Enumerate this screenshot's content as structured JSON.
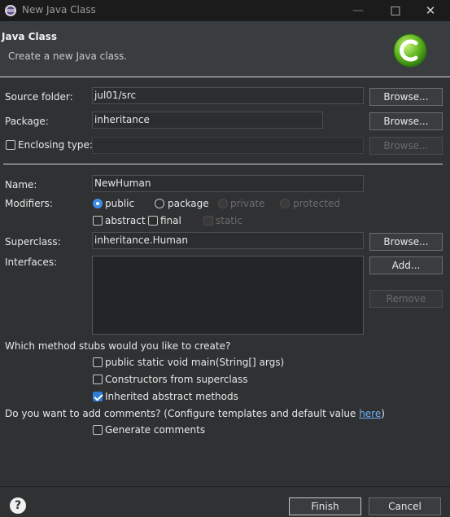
{
  "window": {
    "title": "New Java Class"
  },
  "header": {
    "title": "Java Class",
    "subtitle": "Create a new Java class."
  },
  "source_folder": {
    "label": "Source folder:",
    "value": "jul01/src",
    "browse": "Browse..."
  },
  "package": {
    "label": "Package:",
    "value": "inheritance",
    "browse": "Browse..."
  },
  "enclosing_type": {
    "label": "Enclosing type:",
    "value": "",
    "browse": "Browse..."
  },
  "name": {
    "label": "Name:",
    "value": "NewHuman"
  },
  "modifiers": {
    "label": "Modifiers:",
    "public": "public",
    "package": "package",
    "private": "private",
    "protected": "protected",
    "abstract": "abstract",
    "final": "final",
    "static": "static",
    "selected": "public"
  },
  "superclass": {
    "label": "Superclass:",
    "value": "inheritance.Human",
    "browse": "Browse..."
  },
  "interfaces": {
    "label": "Interfaces:",
    "add": "Add...",
    "remove": "Remove"
  },
  "stubs": {
    "question": "Which method stubs would you like to create?",
    "main": "public static void main(String[] args)",
    "constructors": "Constructors from superclass",
    "inherited": "Inherited abstract methods"
  },
  "comments": {
    "question": "Do you want to add comments? (Configure templates and default value ",
    "link": "here",
    "question_end": ")",
    "generate": "Generate comments"
  },
  "footer": {
    "help": "?",
    "finish": "Finish",
    "cancel": "Cancel"
  },
  "colors": {
    "accent": "#2b7fd6",
    "background": "#2f3133",
    "header": "#3a3d40"
  }
}
